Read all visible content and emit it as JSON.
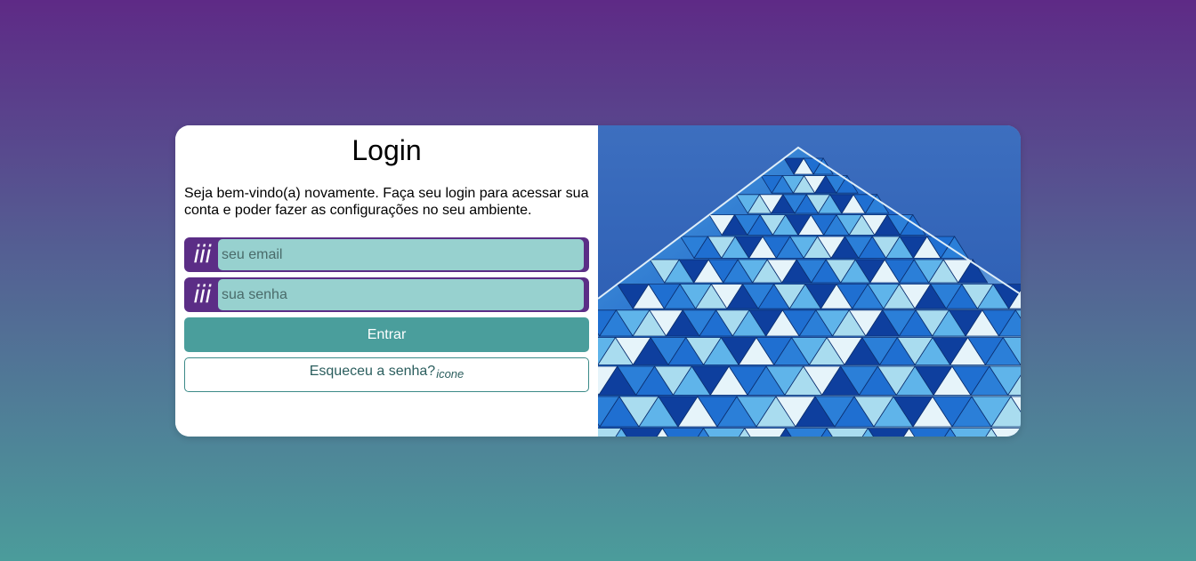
{
  "login": {
    "title": "Login",
    "subtitle": "Seja bem-vindo(a) novamente. Faça seu login para acessar sua conta e poder fazer as configurações no seu ambiente.",
    "email_icon": "iii",
    "email_placeholder": "seu email",
    "password_icon": "iii",
    "password_placeholder": "sua senha",
    "enter_label": "Entrar",
    "forgot_label": "Esqueceu a senha?",
    "forgot_icon_text": "icone"
  },
  "colors": {
    "brand_purple": "#5b2d86",
    "accent_teal": "#4a9e9c",
    "input_fill": "#97d1cf"
  },
  "illustration": {
    "icon": "building-facade-image"
  }
}
